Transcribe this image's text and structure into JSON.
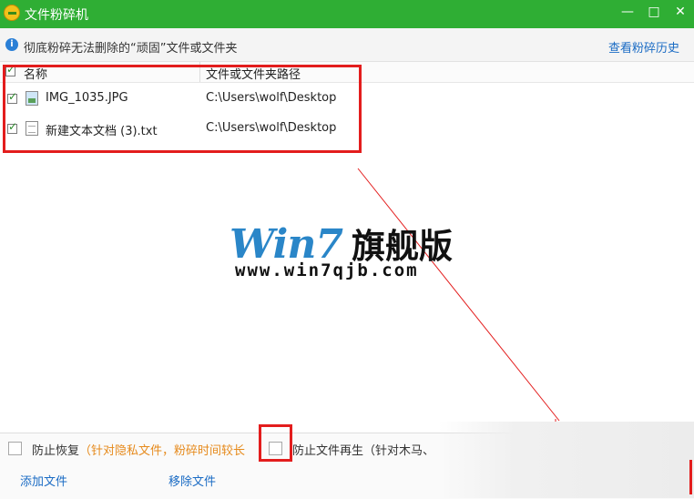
{
  "window": {
    "title": "文件粉碎机",
    "minimize": "—",
    "maximize": "□",
    "close": "✕"
  },
  "info": {
    "text": "彻底粉碎无法删除的“顽固”文件或文件夹",
    "history_link": "查看粉碎历史"
  },
  "list": {
    "columns": [
      "名称",
      "文件或文件夹路径"
    ],
    "rows": [
      {
        "name": "IMG_1035.JPG",
        "path": "C:\\Users\\wolf\\Desktop",
        "checked": true,
        "icon": "image-file-icon"
      },
      {
        "name": "新建文本文档 (3).txt",
        "path": "C:\\Users\\wolf\\Desktop",
        "checked": true,
        "icon": "text-file-icon"
      }
    ]
  },
  "watermark": {
    "brand": "Win7",
    "brand_cn": "旗舰版",
    "url": "www.win7qjb.com"
  },
  "options": {
    "prevent_recovery": "防止恢复",
    "prevent_recovery_note": "（针对隐私文件，粉碎时间较长",
    "prevent_regen": "防止文件再生",
    "prevent_regen_note": "（针对木马、",
    "prevent_recovery_checked": false,
    "prevent_regen_checked": false
  },
  "actions": {
    "add": "添加文件",
    "remove": "移除文件"
  },
  "colors": {
    "titlebar": "#2fae34",
    "link": "#1a6bc4",
    "highlight": "#e31d1d",
    "note": "#e68a1c"
  }
}
